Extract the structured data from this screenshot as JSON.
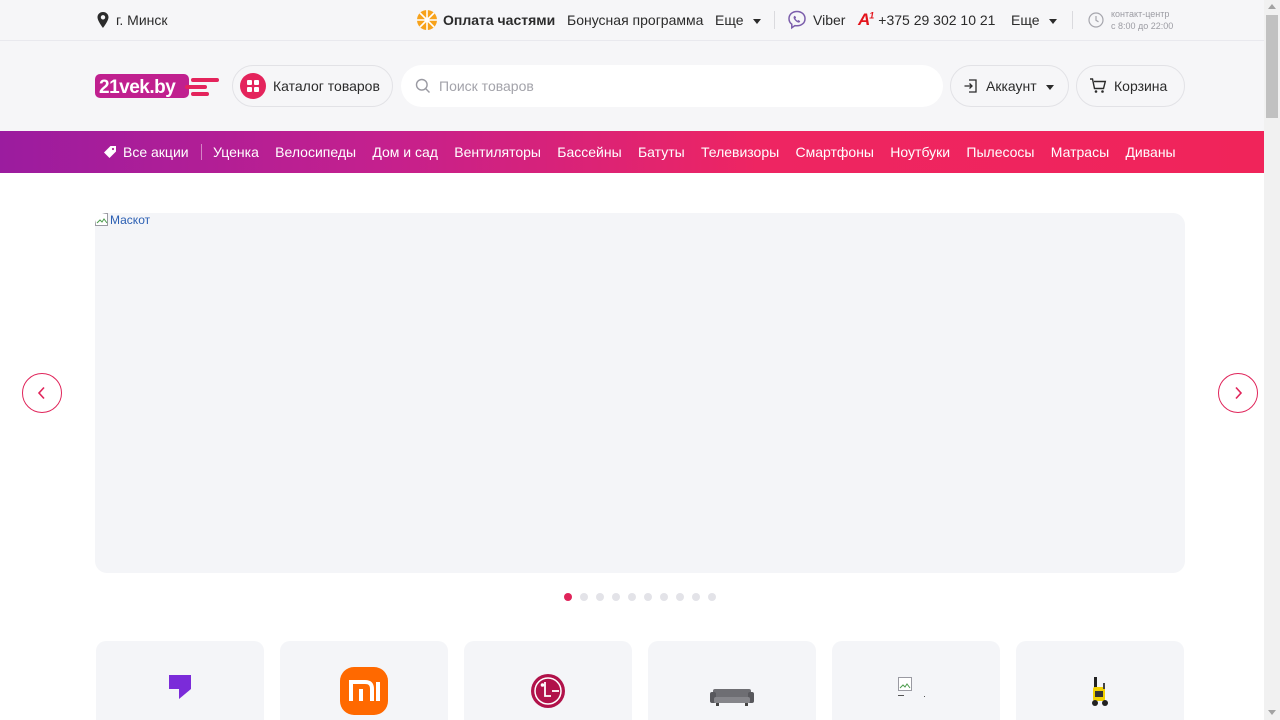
{
  "topbar": {
    "city": "г. Минск",
    "installment": "Оплата частями",
    "bonus": "Бонусная программа",
    "more_1": "Еще",
    "viber": "Viber",
    "phone": "+375 29 302 10 21",
    "more_2": "Еще",
    "hours_line1": "контакт-центр",
    "hours_line2": "с 8:00 до 22:00",
    "phone_brand_mark": "A1"
  },
  "header": {
    "logo_text": "21vek.by",
    "catalog_label": "Каталог товаров",
    "search_placeholder": "Поиск товаров",
    "account_label": "Аккаунт",
    "cart_label": "Корзина"
  },
  "nav": {
    "promo_label": "Все акции",
    "links": [
      "Уценка",
      "Велосипеды",
      "Дом и сад",
      "Вентиляторы",
      "Бассейны",
      "Батуты",
      "Телевизоры",
      "Смартфоны",
      "Ноутбуки",
      "Пылесосы",
      "Матрасы",
      "Диваны"
    ]
  },
  "banner": {
    "broken_image_alt": "Маскот",
    "slide_count": 10,
    "active_slide": 1
  },
  "brands": [
    {
      "icon": "purple-bookmark-logo-icon"
    },
    {
      "icon": "xiaomi-mi-logo-icon"
    },
    {
      "icon": "lg-logo-icon"
    },
    {
      "icon": "sofa-icon"
    },
    {
      "icon": "broken-image-icon"
    },
    {
      "icon": "pressure-washer-icon"
    }
  ],
  "colors": {
    "accent": "#e0245a",
    "nav_gradient_start": "#9b1c9f",
    "nav_gradient_end": "#f0245a",
    "topbar_bg": "#f6f6f8"
  }
}
